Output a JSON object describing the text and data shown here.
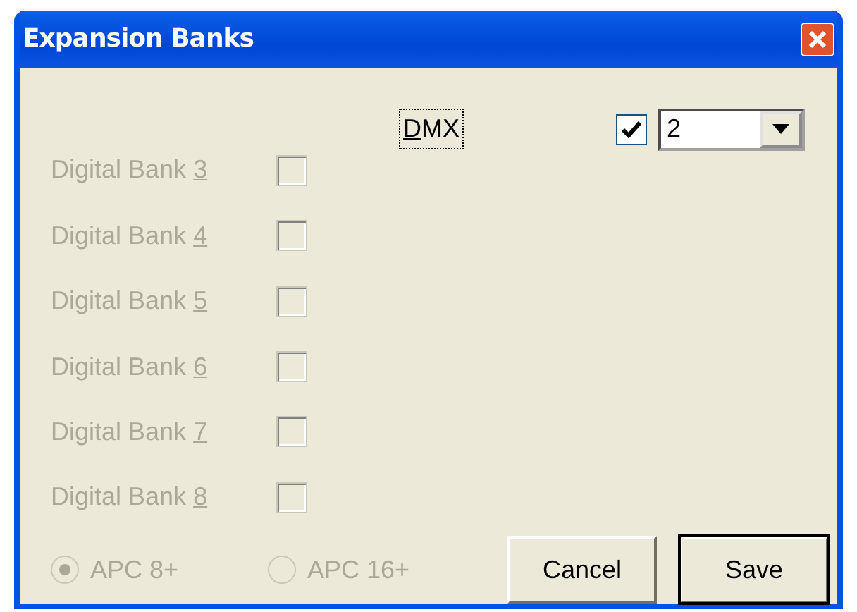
{
  "window": {
    "title": "Expansion Banks"
  },
  "dmx": {
    "label": "DMX",
    "focused": true,
    "checked": true,
    "count": "2"
  },
  "banks": [
    {
      "label": "Digital Bank 3",
      "checked": false,
      "disabled": true
    },
    {
      "label": "Digital Bank 4",
      "checked": false,
      "disabled": true
    },
    {
      "label": "Digital Bank 5",
      "checked": false,
      "disabled": true
    },
    {
      "label": "Digital Bank 6",
      "checked": false,
      "disabled": true
    },
    {
      "label": "Digital Bank 7",
      "checked": false,
      "disabled": true
    },
    {
      "label": "Digital Bank 8",
      "checked": false,
      "disabled": true
    }
  ],
  "models": [
    {
      "label": "APC 8+",
      "selected": true,
      "disabled": true
    },
    {
      "label": "APC 16+",
      "selected": false,
      "disabled": true
    }
  ],
  "buttons": [
    {
      "label": "Cancel",
      "default": false
    },
    {
      "label": "Save",
      "default": true
    }
  ]
}
